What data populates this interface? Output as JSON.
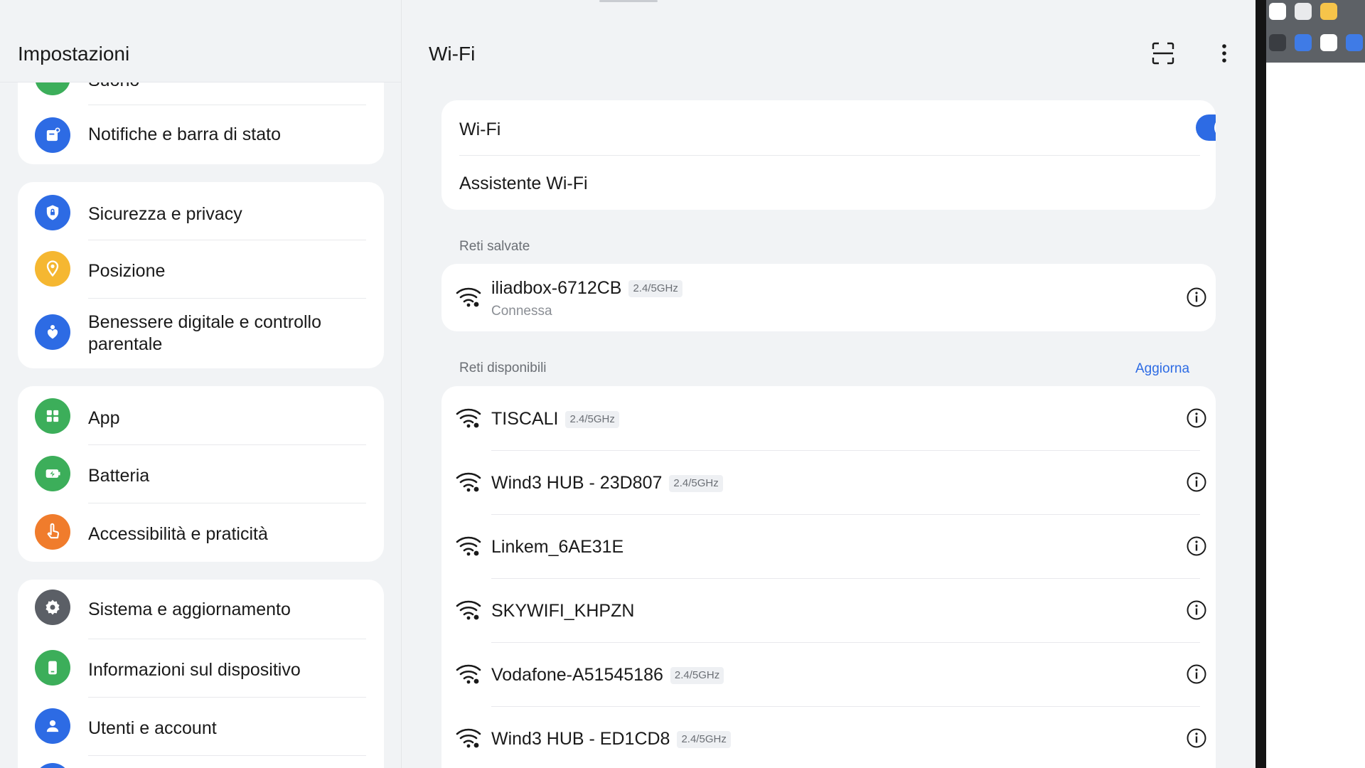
{
  "settings_panel": {
    "title": "Impostazioni",
    "partial_item": {
      "label": "Suono",
      "color": "#3cae5a"
    },
    "groups": [
      {
        "items": [
          {
            "label": "Notifiche e barra di stato",
            "icon": "notification-icon",
            "color": "#2d6be4"
          }
        ]
      },
      {
        "items": [
          {
            "label": "Sicurezza e privacy",
            "icon": "shield-lock-icon",
            "color": "#2d6be4"
          },
          {
            "label": "Posizione",
            "icon": "location-pin-icon",
            "color": "#f5b731"
          },
          {
            "label": "Benessere digitale e controllo parentale",
            "icon": "heart-person-icon",
            "color": "#2d6be4"
          }
        ]
      },
      {
        "items": [
          {
            "label": "App",
            "icon": "apps-grid-icon",
            "color": "#3cae5a"
          },
          {
            "label": "Batteria",
            "icon": "battery-icon",
            "color": "#3cae5a"
          },
          {
            "label": "Accessibilità e praticità",
            "icon": "hand-pointer-icon",
            "color": "#f07c2c"
          }
        ]
      },
      {
        "items": [
          {
            "label": "Sistema e aggiornamento",
            "icon": "gear-icon",
            "color": "#5b5f66"
          },
          {
            "label": "Informazioni sul dispositivo",
            "icon": "device-icon",
            "color": "#3cae5a"
          },
          {
            "label": "Utenti e account",
            "icon": "user-icon",
            "color": "#2d6be4"
          }
        ]
      }
    ]
  },
  "wifi_panel": {
    "title": "Wi-Fi",
    "toggle_row": {
      "label": "Wi-Fi",
      "enabled": true
    },
    "assistant_row": {
      "label": "Assistente Wi-Fi"
    },
    "saved_section": {
      "label": "Reti salvate",
      "networks": [
        {
          "name": "iliadbox-6712CB",
          "band": "2.4/5GHz",
          "status": "Connessa"
        }
      ]
    },
    "available_section": {
      "label": "Reti disponibili",
      "refresh_label": "Aggiorna",
      "networks": [
        {
          "name": "TISCALI",
          "band": "2.4/5GHz"
        },
        {
          "name": "Wind3 HUB - 23D807",
          "band": "2.4/5GHz"
        },
        {
          "name": "Linkem_6AE31E",
          "band": ""
        },
        {
          "name": "SKYWIFI_KHPZN",
          "band": ""
        },
        {
          "name": "Vodafone-A51545186",
          "band": "2.4/5GHz"
        },
        {
          "name": "Wind3 HUB - ED1CD8",
          "band": "2.4/5GHz"
        }
      ]
    }
  },
  "colors": {
    "accent": "#2d6be4",
    "background": "#f1f3f5",
    "card": "#ffffff"
  }
}
